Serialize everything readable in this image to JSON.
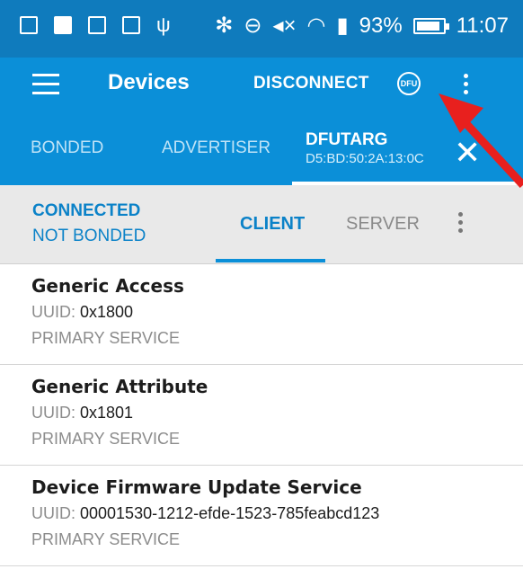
{
  "status_bar": {
    "battery_percent": "93%",
    "battery_level": 0.93,
    "time": "11:07",
    "icons": [
      "notification-box-icon",
      "mail-icon",
      "code-icon",
      "code-icon",
      "usb-icon",
      "bluetooth-icon",
      "do-not-disturb-icon",
      "mute-icon",
      "wifi-icon",
      "signal-icon"
    ]
  },
  "app_bar": {
    "title": "Devices",
    "disconnect_label": "DISCONNECT",
    "dfu_label": "DFU"
  },
  "tabs": {
    "bonded": "BONDED",
    "advertiser": "ADVERTISER",
    "device_name": "DFUTARG",
    "device_address": "D5:BD:50:2A:13:0C",
    "close_glyph": "✕"
  },
  "connection": {
    "state": "CONNECTED",
    "bond_state": "NOT BONDED",
    "client_tab": "CLIENT",
    "server_tab": "SERVER"
  },
  "services": [
    {
      "name": "Generic Access",
      "uuid_label": "UUID: ",
      "uuid": "0x1800",
      "type": "PRIMARY SERVICE"
    },
    {
      "name": "Generic Attribute",
      "uuid_label": "UUID: ",
      "uuid": "0x1801",
      "type": "PRIMARY SERVICE"
    },
    {
      "name": "Device Firmware Update Service",
      "uuid_label": "UUID: ",
      "uuid": "00001530-1212-efde-1523-785feabcd123",
      "type": "PRIMARY SERVICE"
    }
  ],
  "colors": {
    "status_bar": "#0f7bbd",
    "app_bar": "#0b8fd8",
    "accent": "#0b82c8",
    "annotation_arrow": "#e8201e"
  }
}
